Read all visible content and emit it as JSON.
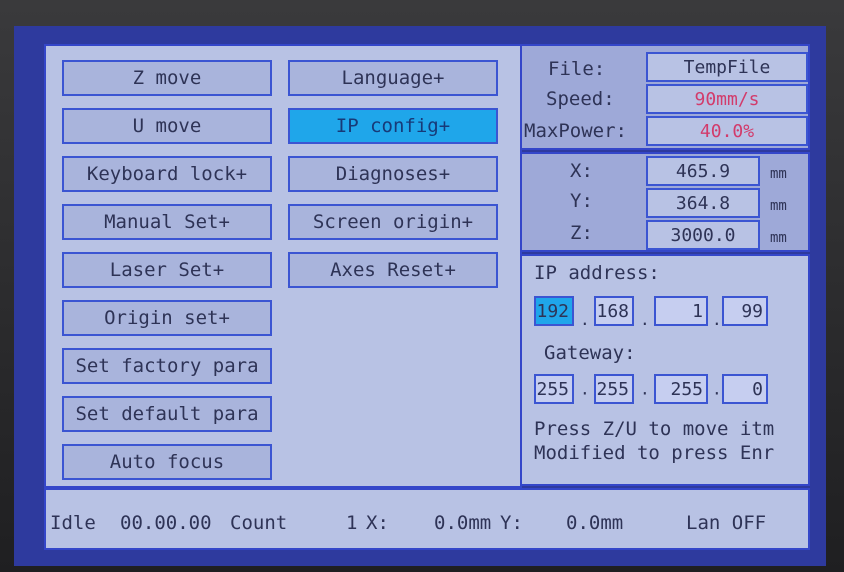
{
  "menu": {
    "left": [
      "Z move",
      "U move",
      "Keyboard lock+",
      "Manual Set+",
      "Laser Set+",
      "Origin set+",
      "Set factory para",
      "Set default para",
      "Auto focus"
    ],
    "right": [
      "Language+",
      "IP config+",
      "Diagnoses+",
      "Screen origin+",
      "Axes Reset+"
    ],
    "selected": "IP config+"
  },
  "file_panel": {
    "file_label": "File:",
    "file_value": "TempFile",
    "speed_label": "Speed:",
    "speed_value": "90mm/s",
    "power_label": "MaxPower:",
    "power_value": "40.0%"
  },
  "coords": {
    "x_label": "X:",
    "x_value": "465.9",
    "x_unit": "mm",
    "y_label": "Y:",
    "y_value": "364.8",
    "y_unit": "mm",
    "z_label": "Z:",
    "z_value": "3000.0",
    "z_unit": "mm"
  },
  "ip_panel": {
    "ip_label": "IP address:",
    "ip": [
      "192",
      "168",
      "1",
      "99"
    ],
    "gateway_label": "Gateway:",
    "gateway": [
      "255",
      "255",
      "255",
      "0"
    ],
    "help_line1": "Press Z/U to move itm",
    "help_line2": "Modified to press Enr"
  },
  "status": {
    "state": "Idle",
    "time": "00.00.00",
    "count_label": "Count",
    "count_value": "1",
    "x_label": "X:",
    "x_value": "0.0mm",
    "y_label": "Y:",
    "y_value": "0.0mm",
    "lan": "Lan OFF"
  },
  "colors": {
    "background": "#b8c2e4",
    "border": "#3446c9",
    "highlight": "#1fa6ea",
    "value_red": "#d23b6b"
  }
}
